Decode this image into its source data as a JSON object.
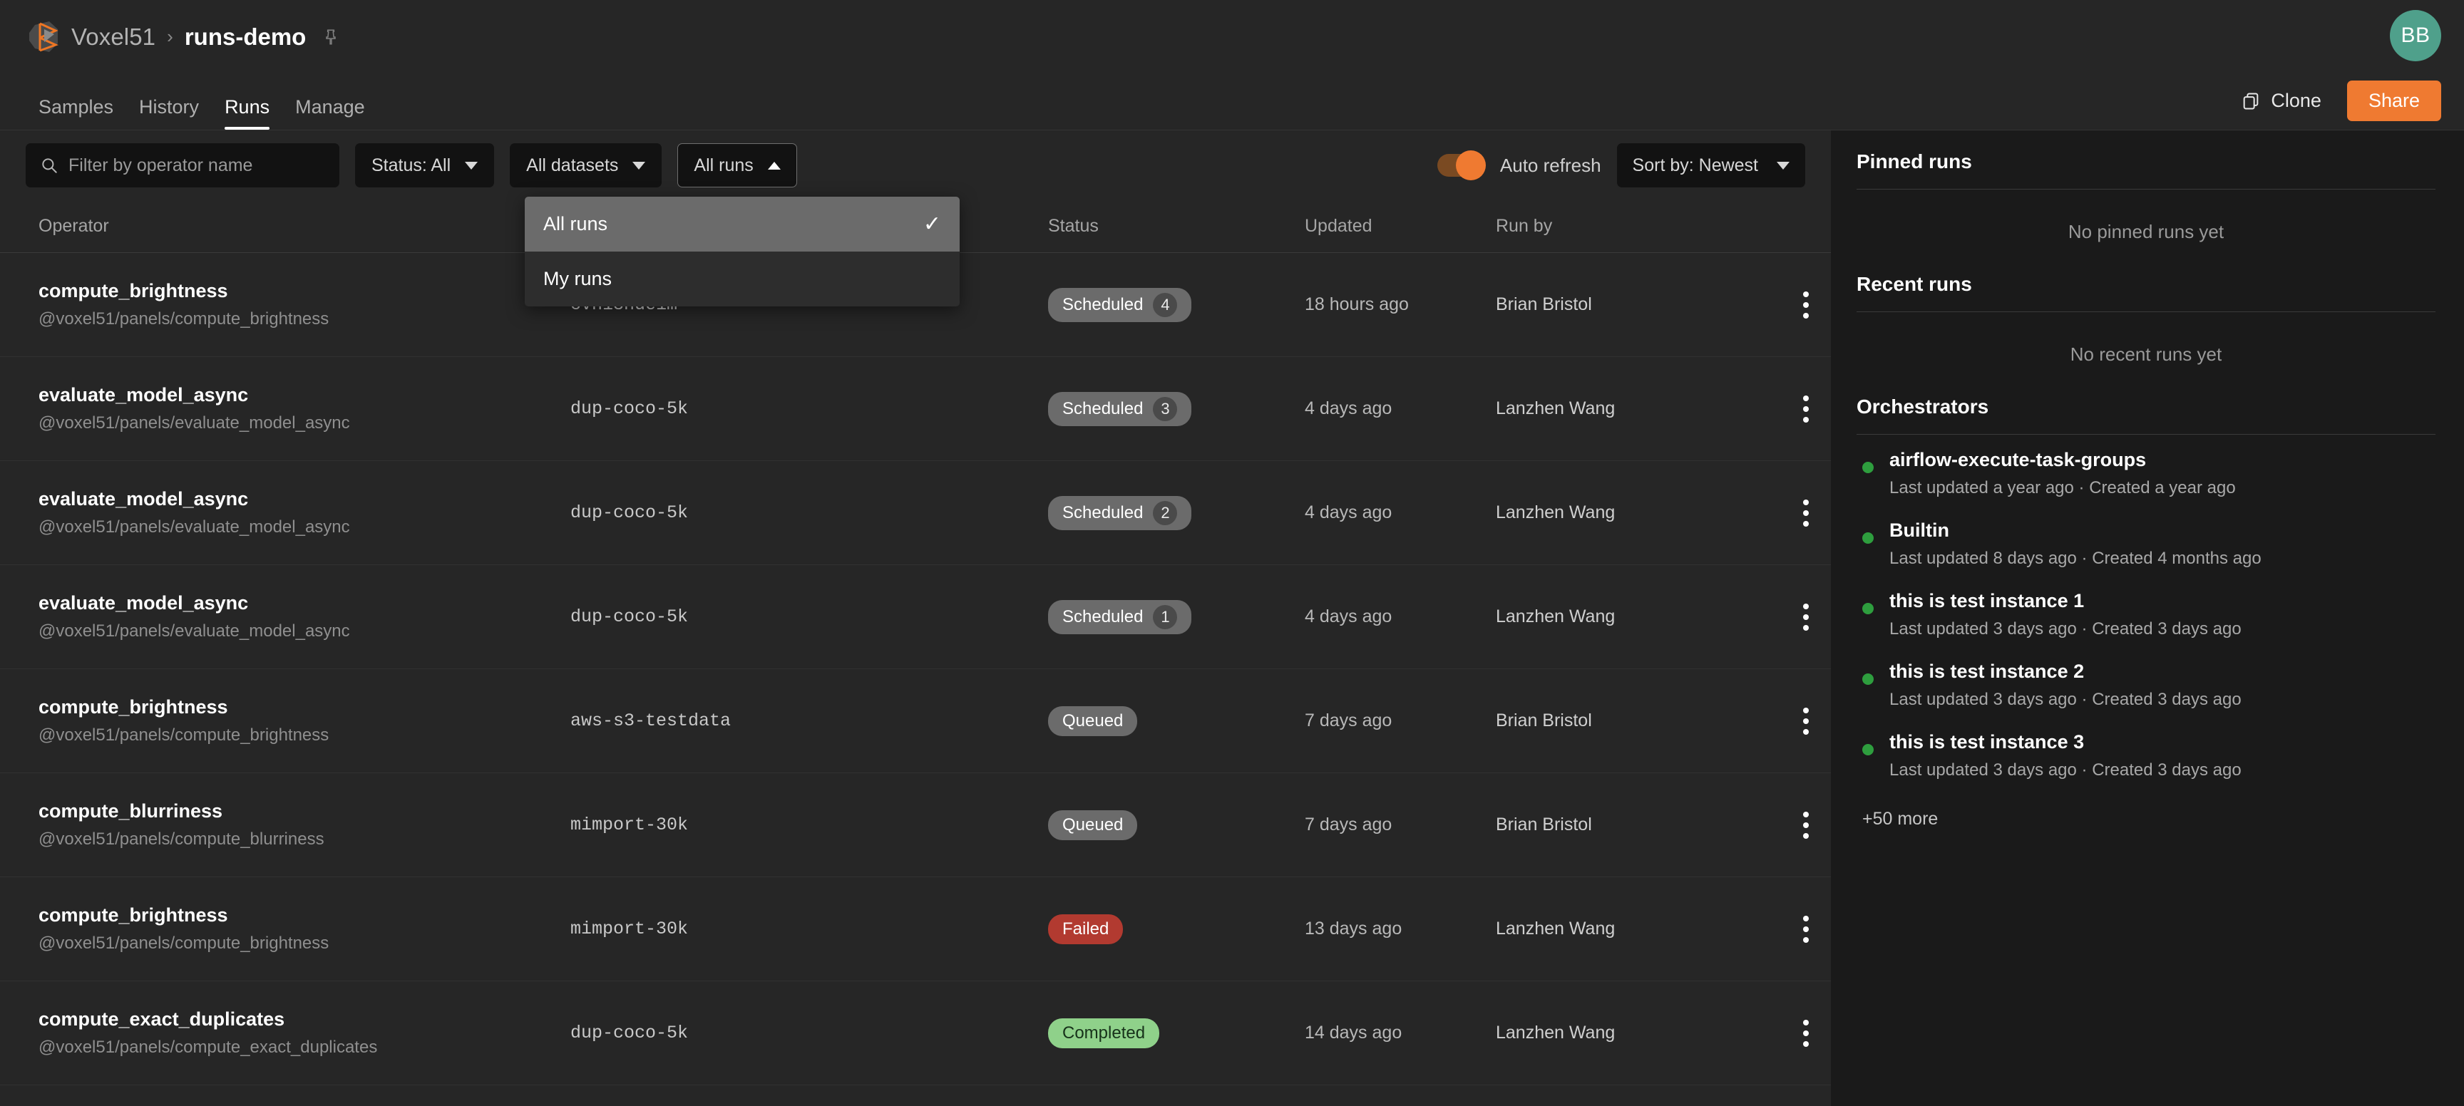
{
  "header": {
    "org": "Voxel51",
    "separator": "›",
    "title": "runs-demo",
    "avatar_initials": "BB",
    "avatar_color": "#4fa08b",
    "clone_label": "Clone",
    "share_label": "Share",
    "share_color": "#ef7a31"
  },
  "tabs": [
    {
      "label": "Samples",
      "active": false
    },
    {
      "label": "History",
      "active": false
    },
    {
      "label": "Runs",
      "active": true
    },
    {
      "label": "Manage",
      "active": false
    }
  ],
  "toolbar": {
    "search_placeholder": "Filter by operator name",
    "search_value": "",
    "search_icon": "search-icon",
    "status_filter": "Status: All",
    "dataset_filter": "All datasets",
    "runs_filter": "All runs",
    "auto_refresh_label": "Auto refresh",
    "auto_refresh_on": true,
    "sort_label": "Sort by: Newest"
  },
  "dropdown": {
    "open": true,
    "items": [
      {
        "label": "All runs",
        "selected": true
      },
      {
        "label": "My runs",
        "selected": false
      }
    ],
    "check_glyph": "✓"
  },
  "table": {
    "columns": [
      "Operator",
      "",
      "Status",
      "Updated",
      "Run by"
    ],
    "rows": [
      {
        "operator": "compute_brightness",
        "uri": "@voxel51/panels/compute_brightness",
        "dataset": "cvh18nde1m",
        "status": "Scheduled",
        "status_kind": "scheduled",
        "count": "4",
        "updated": "18 hours ago",
        "run_by": "Brian Bristol"
      },
      {
        "operator": "evaluate_model_async",
        "uri": "@voxel51/panels/evaluate_model_async",
        "dataset": "dup-coco-5k",
        "status": "Scheduled",
        "status_kind": "scheduled",
        "count": "3",
        "updated": "4 days ago",
        "run_by": "Lanzhen Wang"
      },
      {
        "operator": "evaluate_model_async",
        "uri": "@voxel51/panels/evaluate_model_async",
        "dataset": "dup-coco-5k",
        "status": "Scheduled",
        "status_kind": "scheduled",
        "count": "2",
        "updated": "4 days ago",
        "run_by": "Lanzhen Wang"
      },
      {
        "operator": "evaluate_model_async",
        "uri": "@voxel51/panels/evaluate_model_async",
        "dataset": "dup-coco-5k",
        "status": "Scheduled",
        "status_kind": "scheduled",
        "count": "1",
        "updated": "4 days ago",
        "run_by": "Lanzhen Wang"
      },
      {
        "operator": "compute_brightness",
        "uri": "@voxel51/panels/compute_brightness",
        "dataset": "aws-s3-testdata",
        "status": "Queued",
        "status_kind": "queued",
        "count": "",
        "updated": "7 days ago",
        "run_by": "Brian Bristol"
      },
      {
        "operator": "compute_blurriness",
        "uri": "@voxel51/panels/compute_blurriness",
        "dataset": "mimport-30k",
        "status": "Queued",
        "status_kind": "queued",
        "count": "",
        "updated": "7 days ago",
        "run_by": "Brian Bristol"
      },
      {
        "operator": "compute_brightness",
        "uri": "@voxel51/panels/compute_brightness",
        "dataset": "mimport-30k",
        "status": "Failed",
        "status_kind": "failed",
        "count": "",
        "updated": "13 days ago",
        "run_by": "Lanzhen Wang"
      },
      {
        "operator": "compute_exact_duplicates",
        "uri": "@voxel51/panels/compute_exact_duplicates",
        "dataset": "dup-coco-5k",
        "status": "Completed",
        "status_kind": "completed",
        "count": "",
        "updated": "14 days ago",
        "run_by": "Lanzhen Wang"
      }
    ]
  },
  "sidebar": {
    "pinned_title": "Pinned runs",
    "pinned_empty": "No pinned runs yet",
    "recent_title": "Recent runs",
    "recent_empty": "No recent runs yet",
    "orchestrators_title": "Orchestrators",
    "orchestrators": [
      {
        "name": "airflow-execute-task-groups",
        "meta": "Last updated a year ago  ·  Created a year ago",
        "status_color": "#2e9e3e"
      },
      {
        "name": "Builtin",
        "meta": "Last updated 8 days ago  ·  Created 4 months ago",
        "status_color": "#2e9e3e"
      },
      {
        "name": "this is test instance 1",
        "meta": "Last updated 3 days ago  ·  Created 3 days ago",
        "status_color": "#2e9e3e"
      },
      {
        "name": "this is test instance 2",
        "meta": "Last updated 3 days ago  ·  Created 3 days ago",
        "status_color": "#2e9e3e"
      },
      {
        "name": "this is test instance 3",
        "meta": "Last updated 3 days ago  ·  Created 3 days ago",
        "status_color": "#2e9e3e"
      }
    ],
    "more_label": "+50 more"
  }
}
